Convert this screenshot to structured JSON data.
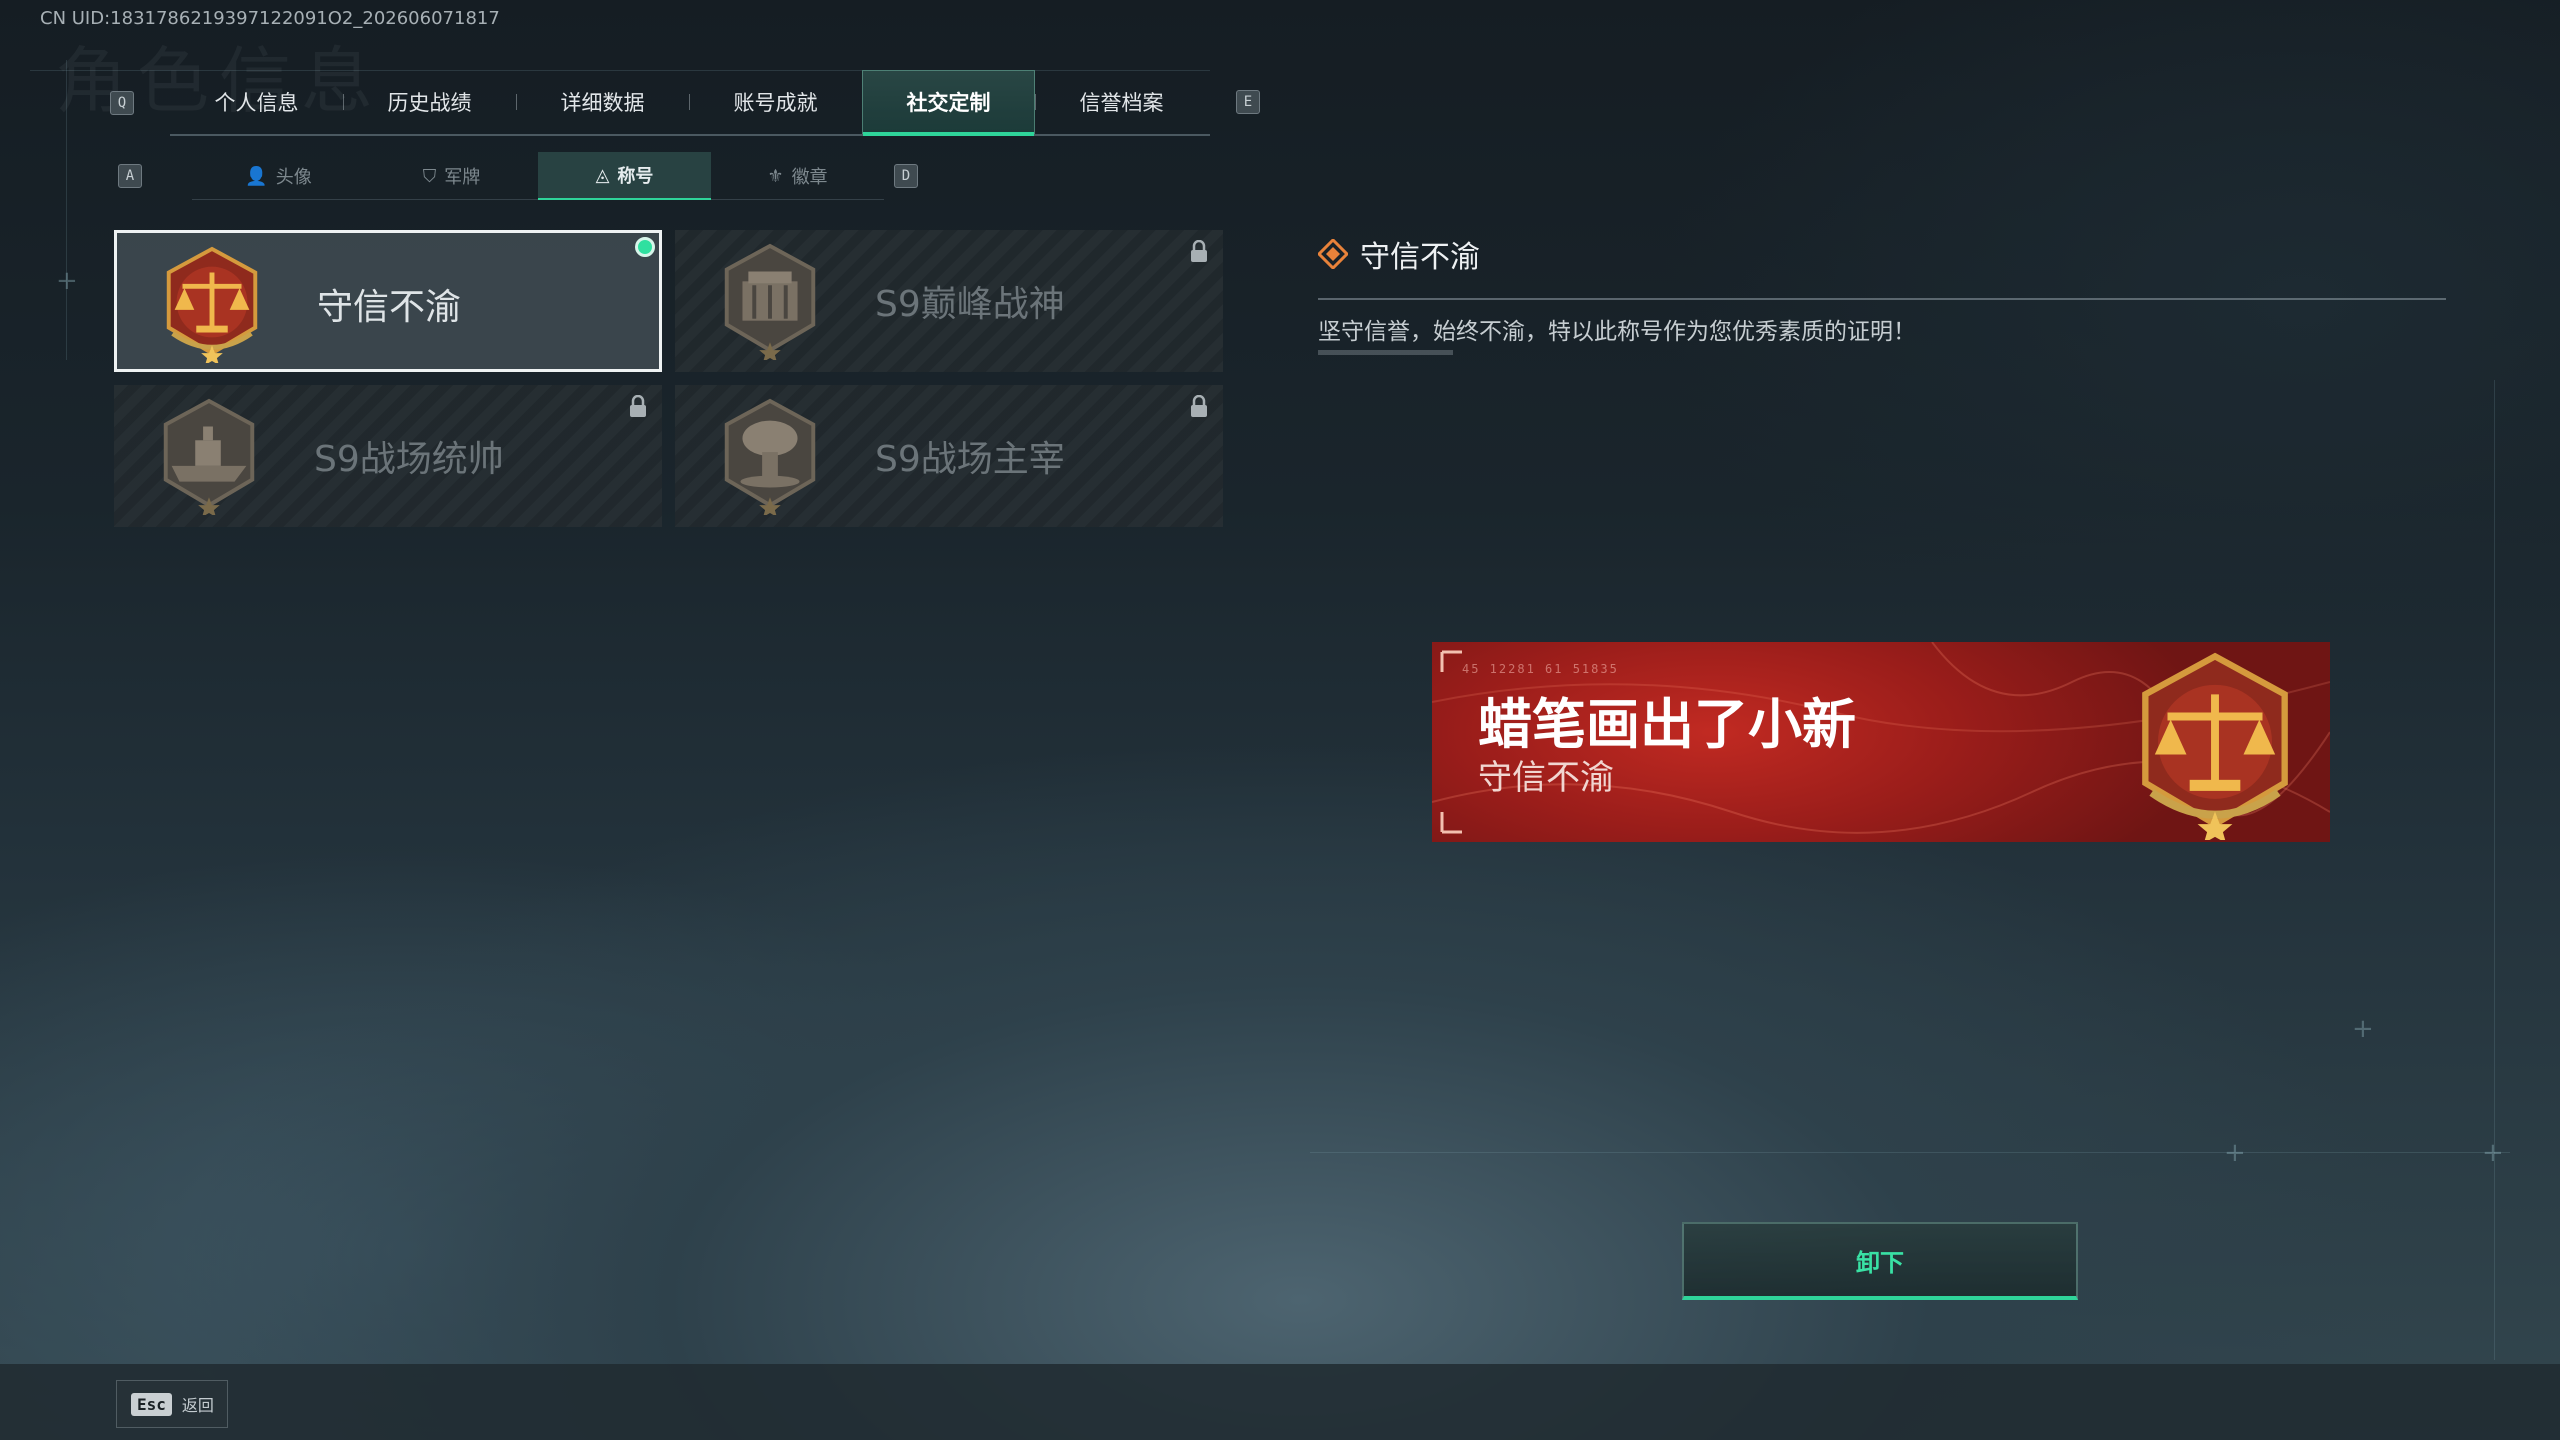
{
  "uid": "CN UID:1831786219397122091O2_202606071817",
  "bg_title": "角色信息",
  "keys": {
    "prev_tab": "Q",
    "next_tab": "E",
    "prev_sub": "A",
    "next_sub": "D"
  },
  "tabs": [
    {
      "label": "个人信息"
    },
    {
      "label": "历史战绩"
    },
    {
      "label": "详细数据"
    },
    {
      "label": "账号成就"
    },
    {
      "label": "社交定制",
      "active": true
    },
    {
      "label": "信誉档案"
    }
  ],
  "subtabs": [
    {
      "label": "头像",
      "icon": "person-icon"
    },
    {
      "label": "军牌",
      "icon": "dogtag-icon"
    },
    {
      "label": "称号",
      "icon": "title-icon",
      "active": true
    },
    {
      "label": "徽章",
      "icon": "badge-icon"
    }
  ],
  "cards": [
    {
      "name": "守信不渝",
      "medal": "scales-medal",
      "selected": true,
      "equipped": true,
      "locked": false
    },
    {
      "name": "S9巅峰战神",
      "medal": "fortress-medal",
      "selected": false,
      "equipped": false,
      "locked": true
    },
    {
      "name": "S9战场统帅",
      "medal": "warship-medal",
      "selected": false,
      "equipped": false,
      "locked": true
    },
    {
      "name": "S9战场主宰",
      "medal": "mushroom-cloud-medal",
      "selected": false,
      "equipped": false,
      "locked": true
    }
  ],
  "detail": {
    "title": "守信不渝",
    "description": "坚守信誉，始终不渝，特以此称号作为您优秀素质的证明！"
  },
  "preview": {
    "player_name": "蜡笔画出了小新",
    "title": "守信不渝",
    "tag": "45 12281 61 51835"
  },
  "actions": {
    "unequip": "卸下"
  },
  "footer": {
    "esc_key": "Esc",
    "esc_label": "返回"
  },
  "colors": {
    "accent": "#2fd49a",
    "banner_red": "#b3231e",
    "medal_gold": "#d99a3a"
  }
}
